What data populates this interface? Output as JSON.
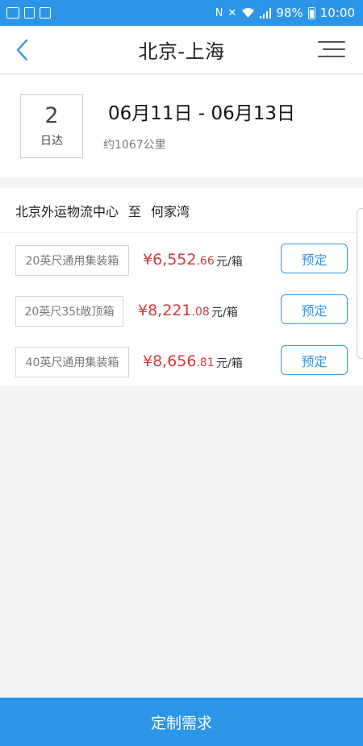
{
  "status_bar": {
    "battery": "98%",
    "time": "10:00",
    "signal_icons": [
      "nfc-icon",
      "mute-icon",
      "wifi-icon",
      "signal-icon"
    ]
  },
  "header": {
    "title": "北京-上海"
  },
  "summary": {
    "days_value": "2",
    "days_unit": "日达",
    "date_range": "06月11日 - 06月13日",
    "distance": "约1067公里"
  },
  "route": {
    "from": "北京外运物流中心",
    "to_word": "至",
    "to": "何家湾"
  },
  "offers": [
    {
      "type": "20英尺通用集装箱",
      "price_main": "¥6,552",
      "price_dec": ".66",
      "unit": "元/箱",
      "button": "预定"
    },
    {
      "type": "20英尺35t敞顶箱",
      "price_main": "¥8,221",
      "price_dec": ".08",
      "unit": "元/箱",
      "button": "预定"
    },
    {
      "type": "40英尺通用集装箱",
      "price_main": "¥8,656",
      "price_dec": ".81",
      "unit": "元/箱",
      "button": "预定"
    }
  ],
  "bottom_button": "定制需求",
  "colors": {
    "primary": "#2c95e8",
    "price": "#d23a3a",
    "background": "#f4f4f4"
  }
}
